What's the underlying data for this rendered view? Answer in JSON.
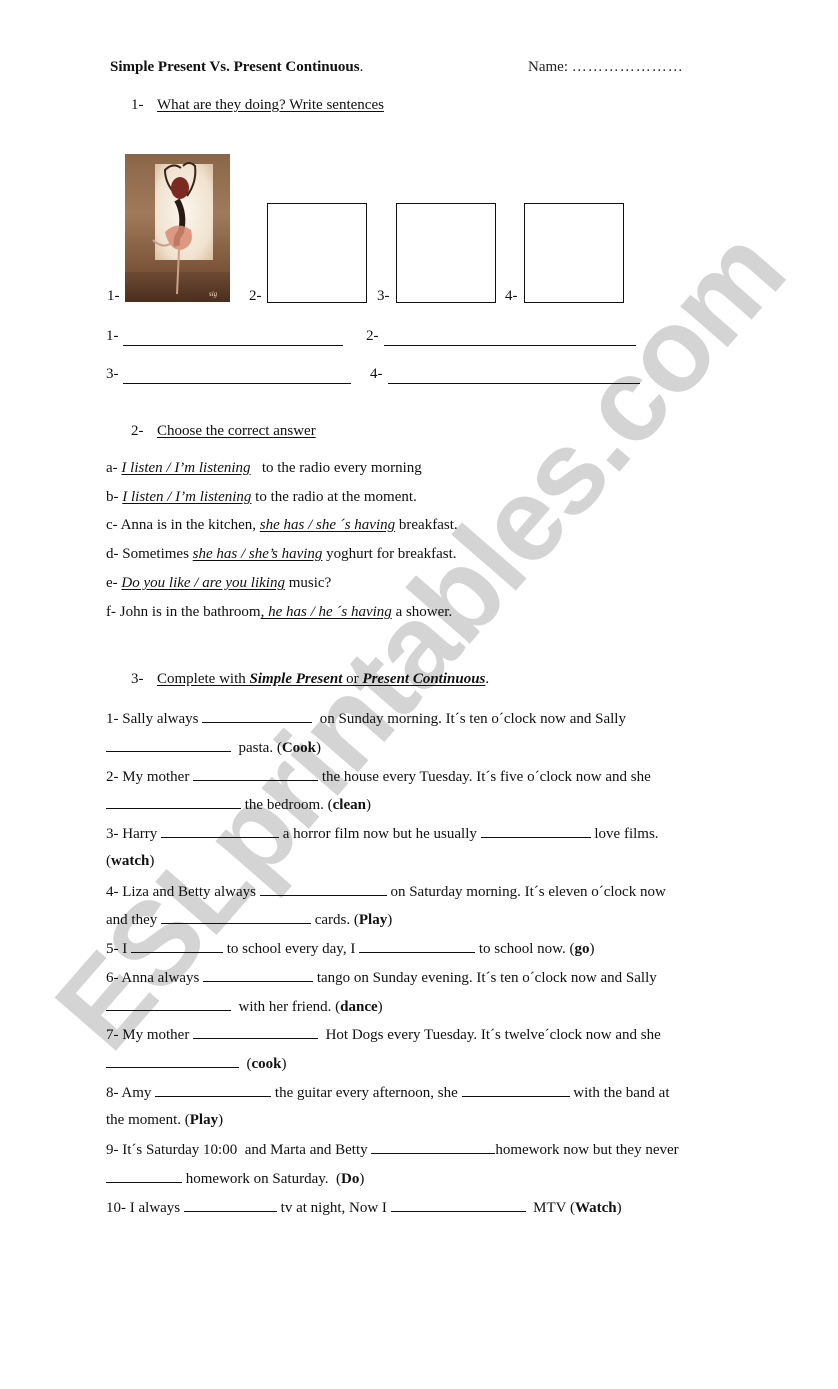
{
  "header": {
    "title": "Simple Present Vs. Present Continuous",
    "title_suffix": ".",
    "name_label": "Name:",
    "name_dots": "…………………"
  },
  "section1": {
    "number": "1-",
    "heading": "What are they doing? Write sentences",
    "pictures": [
      {
        "label": "1-",
        "content": "ballerina-illustration"
      },
      {
        "label": "2-",
        "content": "empty-box"
      },
      {
        "label": "3-",
        "content": "empty-box"
      },
      {
        "label": "4-",
        "content": "empty-box"
      }
    ],
    "answer_labels": [
      "1-",
      "2-",
      "3-",
      "4-"
    ]
  },
  "section2": {
    "number": "2-",
    "heading": "Choose the correct answer",
    "items": [
      {
        "letter": "a-",
        "before": "",
        "option": "I listen / I’m listening",
        "after": "   to the radio every morning"
      },
      {
        "letter": "b-",
        "before": "",
        "option": "I listen / I’m listening",
        "after": " to the radio at the moment."
      },
      {
        "letter": "c-",
        "before": "Anna is in the kitchen, ",
        "option": "she has / she ´s having",
        "after": " breakfast."
      },
      {
        "letter": "d-",
        "before": "Sometimes ",
        "option": "she has / she’s having",
        "after": " yoghurt for breakfast."
      },
      {
        "letter": "e-",
        "before": "",
        "option": "Do you like / are you liking",
        "after": " music?"
      },
      {
        "letter": "f-",
        "before": "John is in the bathroom",
        "option": ", he has / he ´s having",
        "after": " a shower."
      }
    ]
  },
  "section3": {
    "number": "3-",
    "heading_prefix": "Complete with ",
    "heading_bold1": "Simple Present",
    "heading_mid": " or ",
    "heading_bold2": "Present Continuous",
    "heading_suffix": ".",
    "lines": [
      {
        "segments": [
          "1- Sally always ",
          "",
          "  on Sunday morning. It´s ten o´clock now and Sally"
        ]
      },
      {
        "segments": [
          "",
          "  pasta. (",
          "Cook",
          ")"
        ]
      },
      {
        "segments": [
          "2- My mother ",
          "",
          " the house every Tuesday. It´s five o´clock now and she"
        ]
      },
      {
        "segments": [
          "",
          " the bedroom. (",
          "clean",
          ")"
        ]
      },
      {
        "segments": [
          "3- Harry ",
          "",
          " a horror film now but he usually ",
          "",
          " love films."
        ]
      },
      {
        "segments": [
          "(",
          "watch",
          ")"
        ]
      },
      {
        "segments": [
          "4- Liza and Betty always ",
          "",
          " on Saturday morning. It´s eleven o´clock now"
        ]
      },
      {
        "segments": [
          "and they ",
          "",
          " cards. (",
          "Play",
          ")"
        ]
      },
      {
        "segments": [
          "5- I ",
          "",
          " to school every day, I ",
          "",
          " to school now. (",
          "go",
          ")"
        ]
      },
      {
        "segments": [
          "6- Anna always ",
          "",
          " tango on Sunday evening. It´s ten o´clock now and Sally"
        ]
      },
      {
        "segments": [
          "",
          "  with her friend. (",
          "dance",
          ")"
        ]
      },
      {
        "segments": [
          "7- My mother ",
          "",
          "  Hot Dogs every Tuesday. It´s twelve´clock now and she"
        ]
      },
      {
        "segments": [
          "",
          "  (",
          "cook",
          ")"
        ]
      },
      {
        "segments": [
          "8- Amy ",
          "",
          " the guitar every afternoon, she ",
          "",
          " with the band at"
        ]
      },
      {
        "segments": [
          "the moment. (",
          "Play",
          ")"
        ]
      },
      {
        "segments": [
          "9- It´s Saturday 10:00  and Marta and Betty ",
          "",
          "homework now but they never"
        ]
      },
      {
        "segments": [
          "",
          " homework on Saturday.  (",
          "Do",
          ")"
        ]
      },
      {
        "segments": [
          "10- I always ",
          "",
          " tv at night, Now I ",
          "",
          "  MTV (",
          "Watch",
          ")"
        ]
      }
    ]
  },
  "watermark": "ESLprintables.com"
}
